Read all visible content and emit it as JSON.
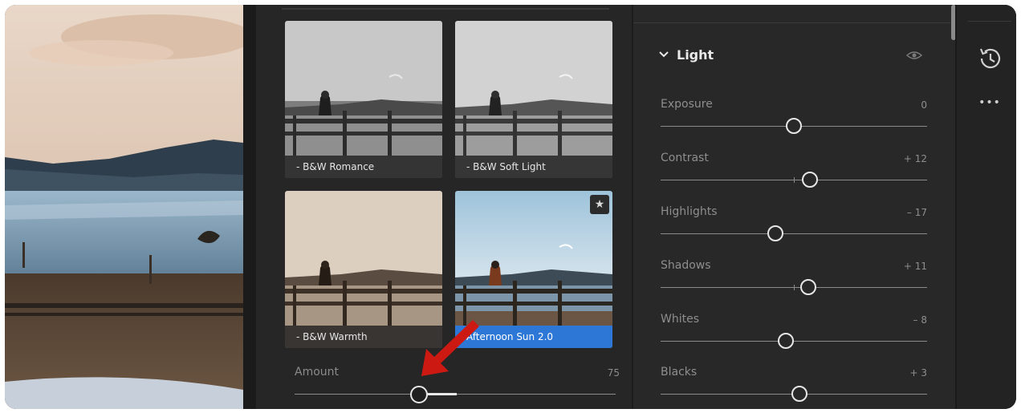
{
  "presets": {
    "thumbnails": [
      {
        "label": "- B&W Romance",
        "style": "bw"
      },
      {
        "label": "- B&W Soft Light",
        "style": "bw"
      },
      {
        "label": "- B&W Warmth",
        "style": "sepia"
      },
      {
        "label": "Afternoon Sun 2.0",
        "style": "color",
        "selected": true,
        "favorite": true
      }
    ],
    "amount": {
      "label": "Amount",
      "value": "75",
      "level": 0.75
    },
    "favorite_icon": "star-icon",
    "arrow_color": "#cc1a12"
  },
  "light_panel": {
    "title": "Light",
    "visibility_icon": "eye-icon",
    "sliders": [
      {
        "label": "Exposure",
        "value": "0",
        "position": 0.5
      },
      {
        "label": "Contrast",
        "value": "+ 12",
        "position": 0.56
      },
      {
        "label": "Highlights",
        "value": "– 17",
        "position": 0.43
      },
      {
        "label": "Shadows",
        "value": "+ 11",
        "position": 0.555
      },
      {
        "label": "Whites",
        "value": "– 8",
        "position": 0.47
      },
      {
        "label": "Blacks",
        "value": "+ 3",
        "position": 0.52
      }
    ]
  },
  "right_strip": {
    "history_icon": "history-icon",
    "more_icon": "more-horizontal-icon",
    "more_glyph": "•••"
  },
  "accent_color": "#2d78d6"
}
